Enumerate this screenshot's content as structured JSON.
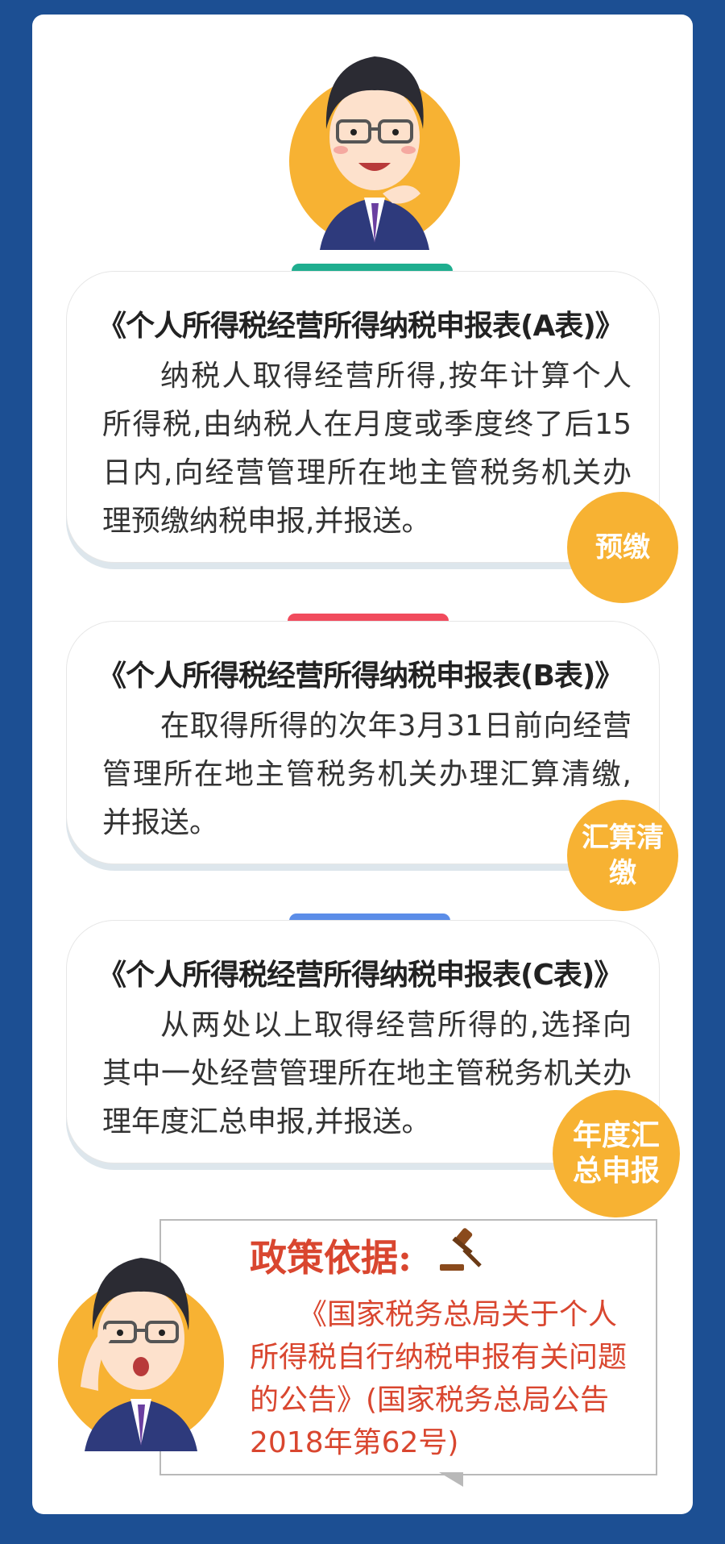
{
  "cards": [
    {
      "title": "《个人所得税经营所得纳税申报表(A表)》",
      "body": "纳税人取得经营所得,按年计算个人所得税,由纳税人在月度或季度终了后15日内,向经营管理所在地主管税务机关办理预缴纳税申报,并报送。",
      "badge": "预缴"
    },
    {
      "title": "《个人所得税经营所得纳税申报表(B表)》",
      "body": "在取得所得的次年3月31日前向经营管理所在地主管税务机关办理汇算清缴,并报送。",
      "badge": "汇算清缴"
    },
    {
      "title": "《个人所得税经营所得纳税申报表(C表)》",
      "body": "从两处以上取得经营所得的,选择向其中一处经营管理所在地主管税务机关办理年度汇总申报,并报送。",
      "badge": "年度汇总申报"
    }
  ],
  "policy": {
    "title": "政策依据:",
    "body": "《国家税务总局关于个人所得税自行纳税申报有关问题的公告》(国家税务总局公告2018年第62号)"
  },
  "colors": {
    "background": "#1c4f93",
    "pill_green": "#1fae8f",
    "pill_red": "#f14b5d",
    "pill_blue": "#5b8de8",
    "badge": "#f7b233",
    "policy_text": "#d9462f"
  },
  "icons": {
    "top_avatar": "man-thinking-avatar",
    "bottom_avatar": "man-adjusting-glasses-avatar",
    "gavel": "gavel-icon"
  }
}
